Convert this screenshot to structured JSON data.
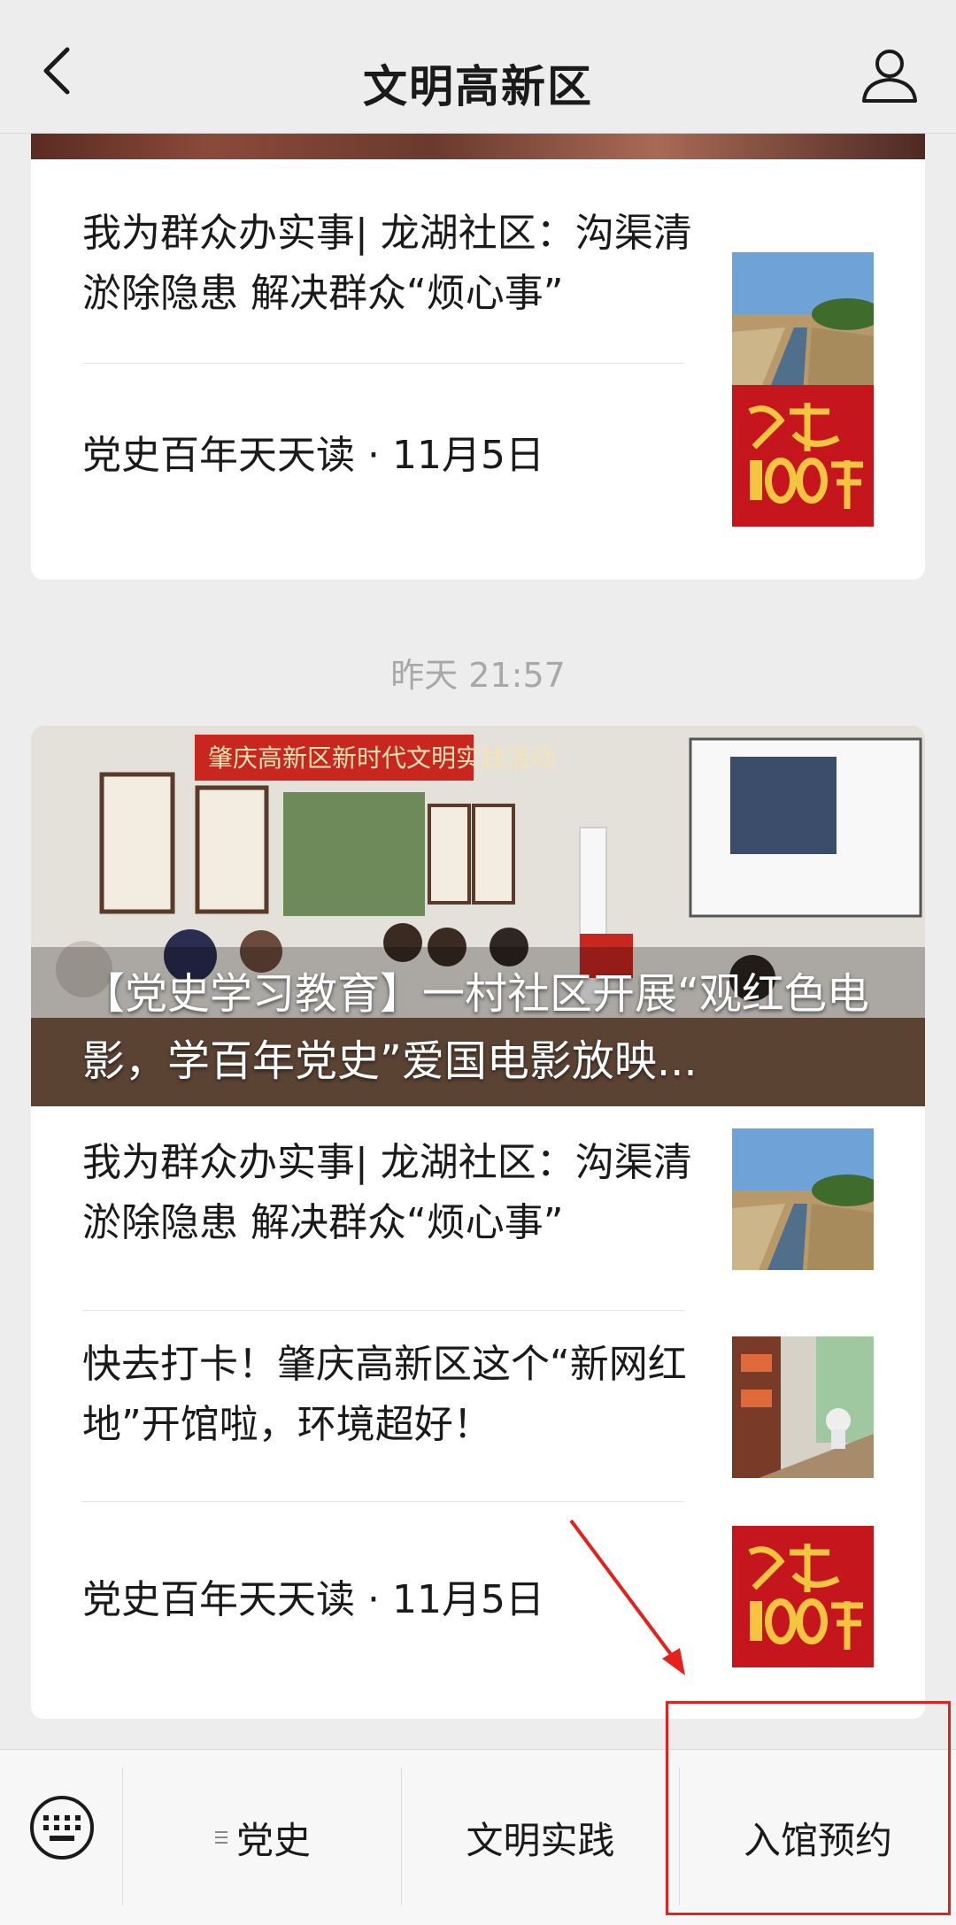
{
  "header": {
    "title": "文明高新区",
    "back_icon": "chevron-left-icon",
    "profile_icon": "user-icon"
  },
  "group1": {
    "items": [
      {
        "text": "我为群众办实事| 龙湖社区：沟渠清淤除隐患 解决群众“烦心事”",
        "thumb": "canal-photo"
      },
      {
        "text": "党史百年天天读 · 11月5日",
        "thumb": "party-history-100-years-logo"
      }
    ]
  },
  "timestamp": "昨天 21:57",
  "group2": {
    "hero": {
      "title": "【党史学习教育】一村社区开展“观红色电影，学百年党史”爱国电影放映...",
      "banner_text": "肇庆高新区新时代文明实践活动"
    },
    "items": [
      {
        "text": "我为群众办实事| 龙湖社区：沟渠清淤除隐患 解决群众“烦心事”",
        "thumb": "canal-photo"
      },
      {
        "text": "快去打卡！肇庆高新区这个“新网红地”开馆啦，环境超好！",
        "thumb": "venue-interior-photo"
      },
      {
        "text": "党史百年天天读 · 11月5日",
        "thumb": "party-history-100-years-logo"
      }
    ]
  },
  "bottom_menu": {
    "keyboard_icon": "keyboard-icon",
    "items": [
      {
        "label": "党史",
        "prefix_icon": "menu-lines-icon"
      },
      {
        "label": "文明实践"
      },
      {
        "label": "入馆预约"
      }
    ]
  },
  "colors": {
    "annotation": "#e5211d",
    "background": "#ededed"
  }
}
